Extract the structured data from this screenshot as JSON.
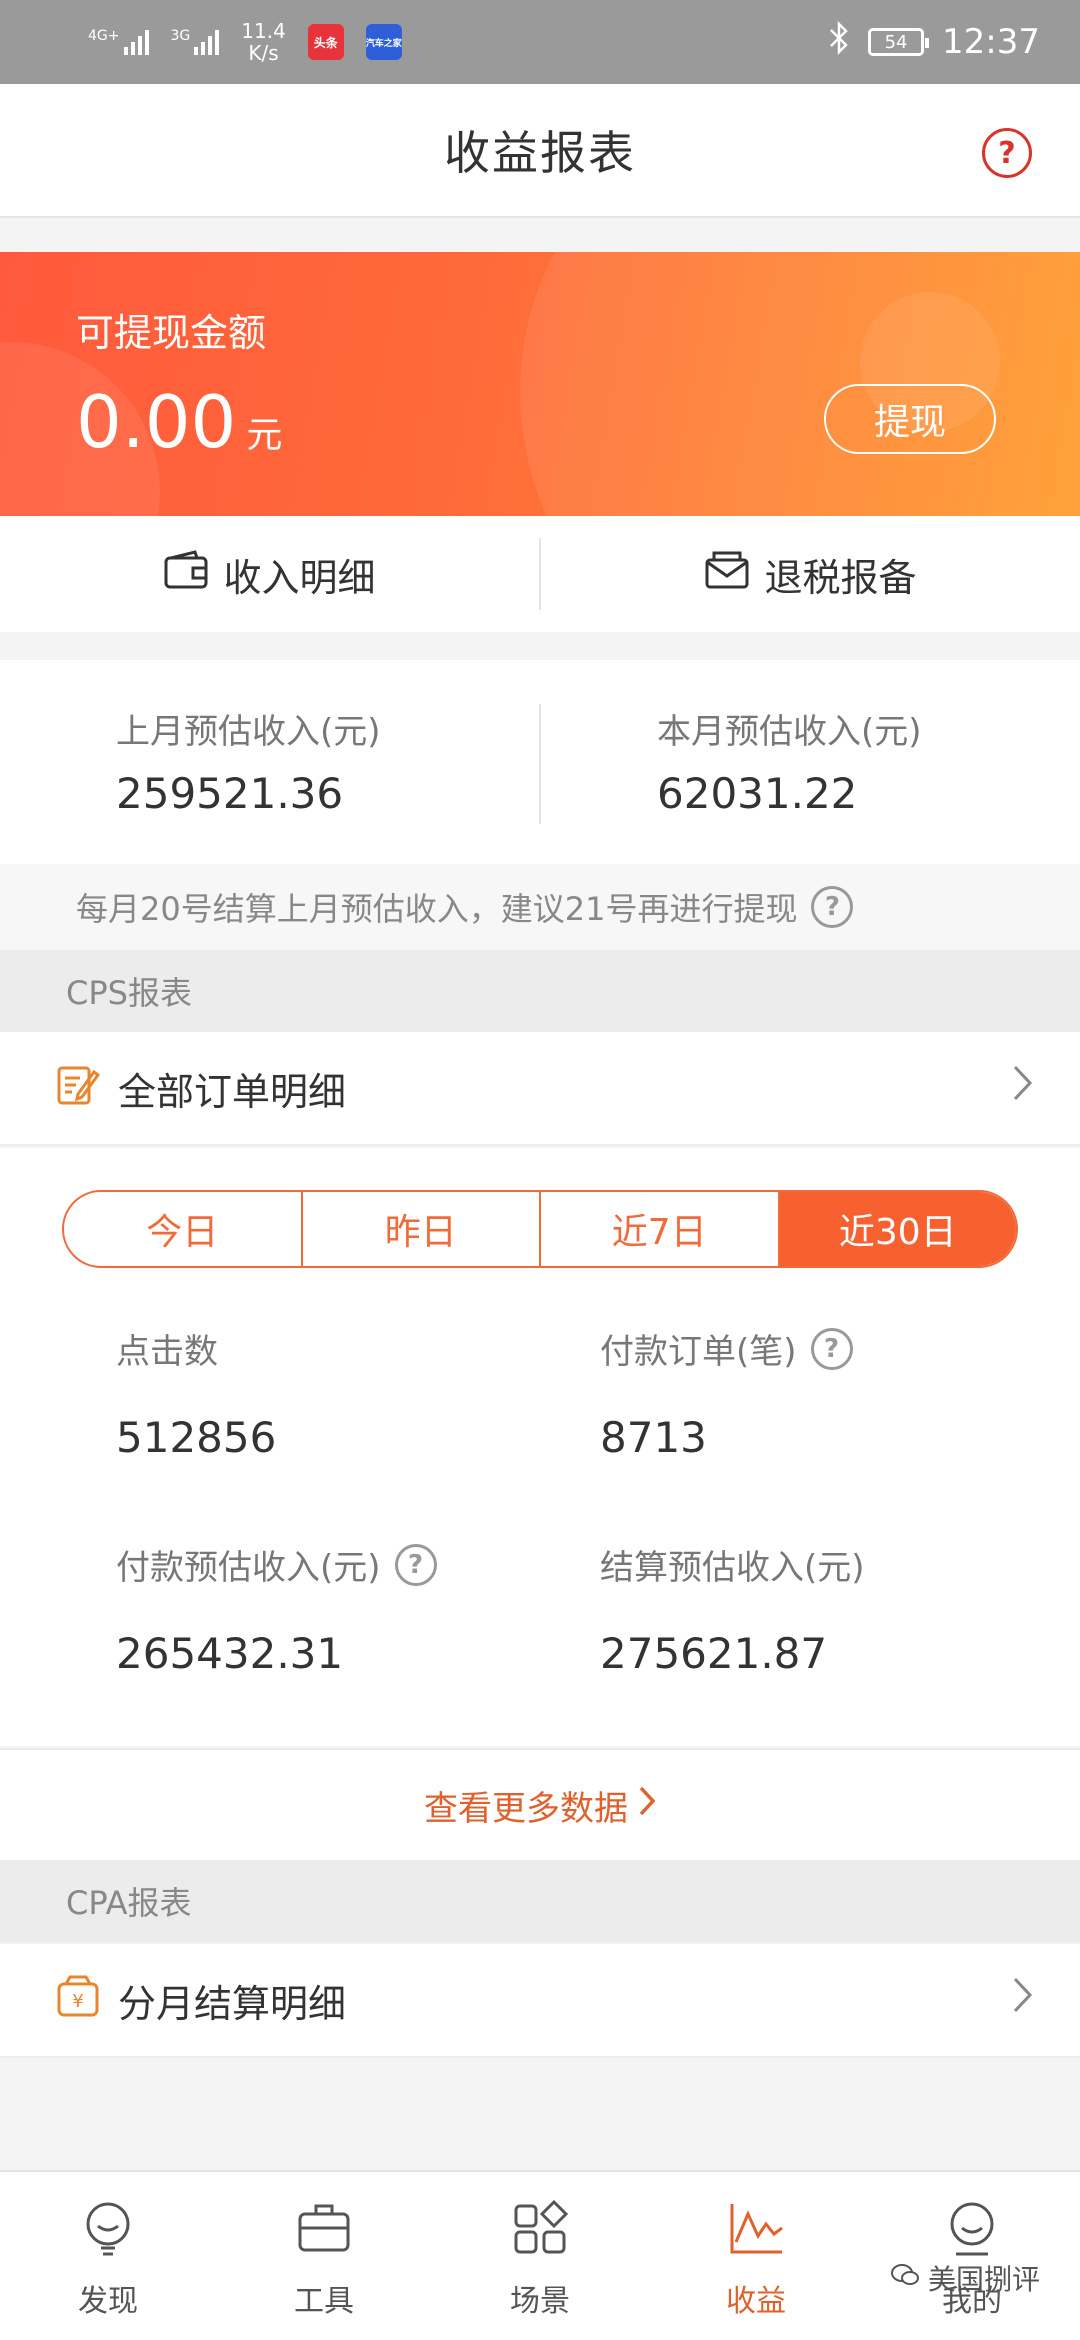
{
  "status_bar": {
    "net1": "4G+",
    "net2": "3G",
    "speed": "11.4",
    "speed_unit": "K/s",
    "app1": "头条",
    "app2": "汽车之家",
    "battery": "54",
    "time": "12:37"
  },
  "header": {
    "title": "收益报表",
    "help": "?"
  },
  "banner": {
    "label": "可提现金额",
    "amount": "0.00",
    "unit": "元",
    "withdraw_label": "提现"
  },
  "actions": {
    "income_detail": "收入明细",
    "tax_report": "退税报备"
  },
  "estimates": {
    "last_month_label": "上月预估收入(元)",
    "last_month_value": "259521.36",
    "this_month_label": "本月预估收入(元)",
    "this_month_value": "62031.22"
  },
  "notice": "每月20号结算上月预估收入，建议21号再进行提现",
  "cps": {
    "section_title": "CPS报表",
    "all_orders": "全部订单明细",
    "tabs": [
      "今日",
      "昨日",
      "近7日",
      "近30日"
    ],
    "active_tab": "近30日",
    "stats": [
      {
        "label": "点击数",
        "value": "512856"
      },
      {
        "label": "付款订单(笔)",
        "value": "8713"
      },
      {
        "label": "付款预估收入(元)",
        "value": "265432.31"
      },
      {
        "label": "结算预估收入(元)",
        "value": "275621.87"
      }
    ],
    "more_label": "查看更多数据"
  },
  "cpa": {
    "section_title": "CPA报表",
    "monthly_detail": "分月结算明细"
  },
  "bottom_nav": [
    {
      "label": "发现",
      "icon": "bulb-icon"
    },
    {
      "label": "工具",
      "icon": "toolbox-icon"
    },
    {
      "label": "场景",
      "icon": "grid-icon"
    },
    {
      "label": "收益",
      "icon": "chart-icon"
    },
    {
      "label": "我的",
      "icon": "user-icon"
    }
  ],
  "watermark": "美国捌评",
  "colors": {
    "accent": "#f6612f",
    "banner_start": "#ff5a3c",
    "banner_end": "#ff9a2a",
    "help_red": "#d9342b"
  }
}
